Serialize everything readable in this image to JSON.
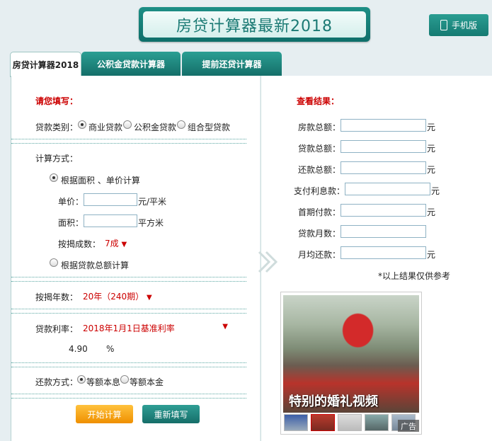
{
  "header": {
    "title": "房贷计算器最新2018",
    "mobile_label": "手机版"
  },
  "tabs": [
    {
      "label": "房贷计算器2018"
    },
    {
      "label": "公积金贷款计算器"
    },
    {
      "label": "提前还贷计算器"
    }
  ],
  "form": {
    "heading": "请您填写：",
    "loan_type_label": "贷款类别：",
    "loan_types": [
      "商业贷款",
      "公积金贷款",
      "组合型贷款"
    ],
    "calc_method_label": "计算方式：",
    "method_area": "根据面积 、单价计算",
    "unit_price_label": "单价：",
    "unit_price_unit": "元/平米",
    "area_label": "面积：",
    "area_unit": "平方米",
    "ratio_label": "按揭成数：",
    "ratio_value": "7成",
    "method_total": "根据贷款总额计算",
    "years_label": "按揭年数：",
    "years_value": "20年（240期）",
    "rate_label": "贷款利率：",
    "rate_value": "2018年1月1日基准利率",
    "rate_number": "4.90",
    "rate_unit": "%",
    "repay_label": "还款方式：",
    "repay_options": [
      "等额本息",
      "等额本金"
    ],
    "start_button": "开始计算",
    "reset_button": "重新填写"
  },
  "results": {
    "heading": "查看结果：",
    "rows": [
      {
        "label": "房款总额：",
        "unit": "元"
      },
      {
        "label": "贷款总额：",
        "unit": "元"
      },
      {
        "label": "还款总额：",
        "unit": "元"
      },
      {
        "label": "支付利息款：",
        "unit": "元"
      },
      {
        "label": "首期付款：",
        "unit": "元"
      },
      {
        "label": "贷款月数：",
        "unit": ""
      },
      {
        "label": "月均还款：",
        "unit": "元"
      }
    ],
    "note": "*以上结果仅供参考"
  },
  "ad": {
    "caption": "特别的婚礼视频",
    "label": "广告"
  },
  "colors": {
    "accent": "#1b7a74",
    "red": "#cc0000",
    "orange": "#ef8f00"
  }
}
